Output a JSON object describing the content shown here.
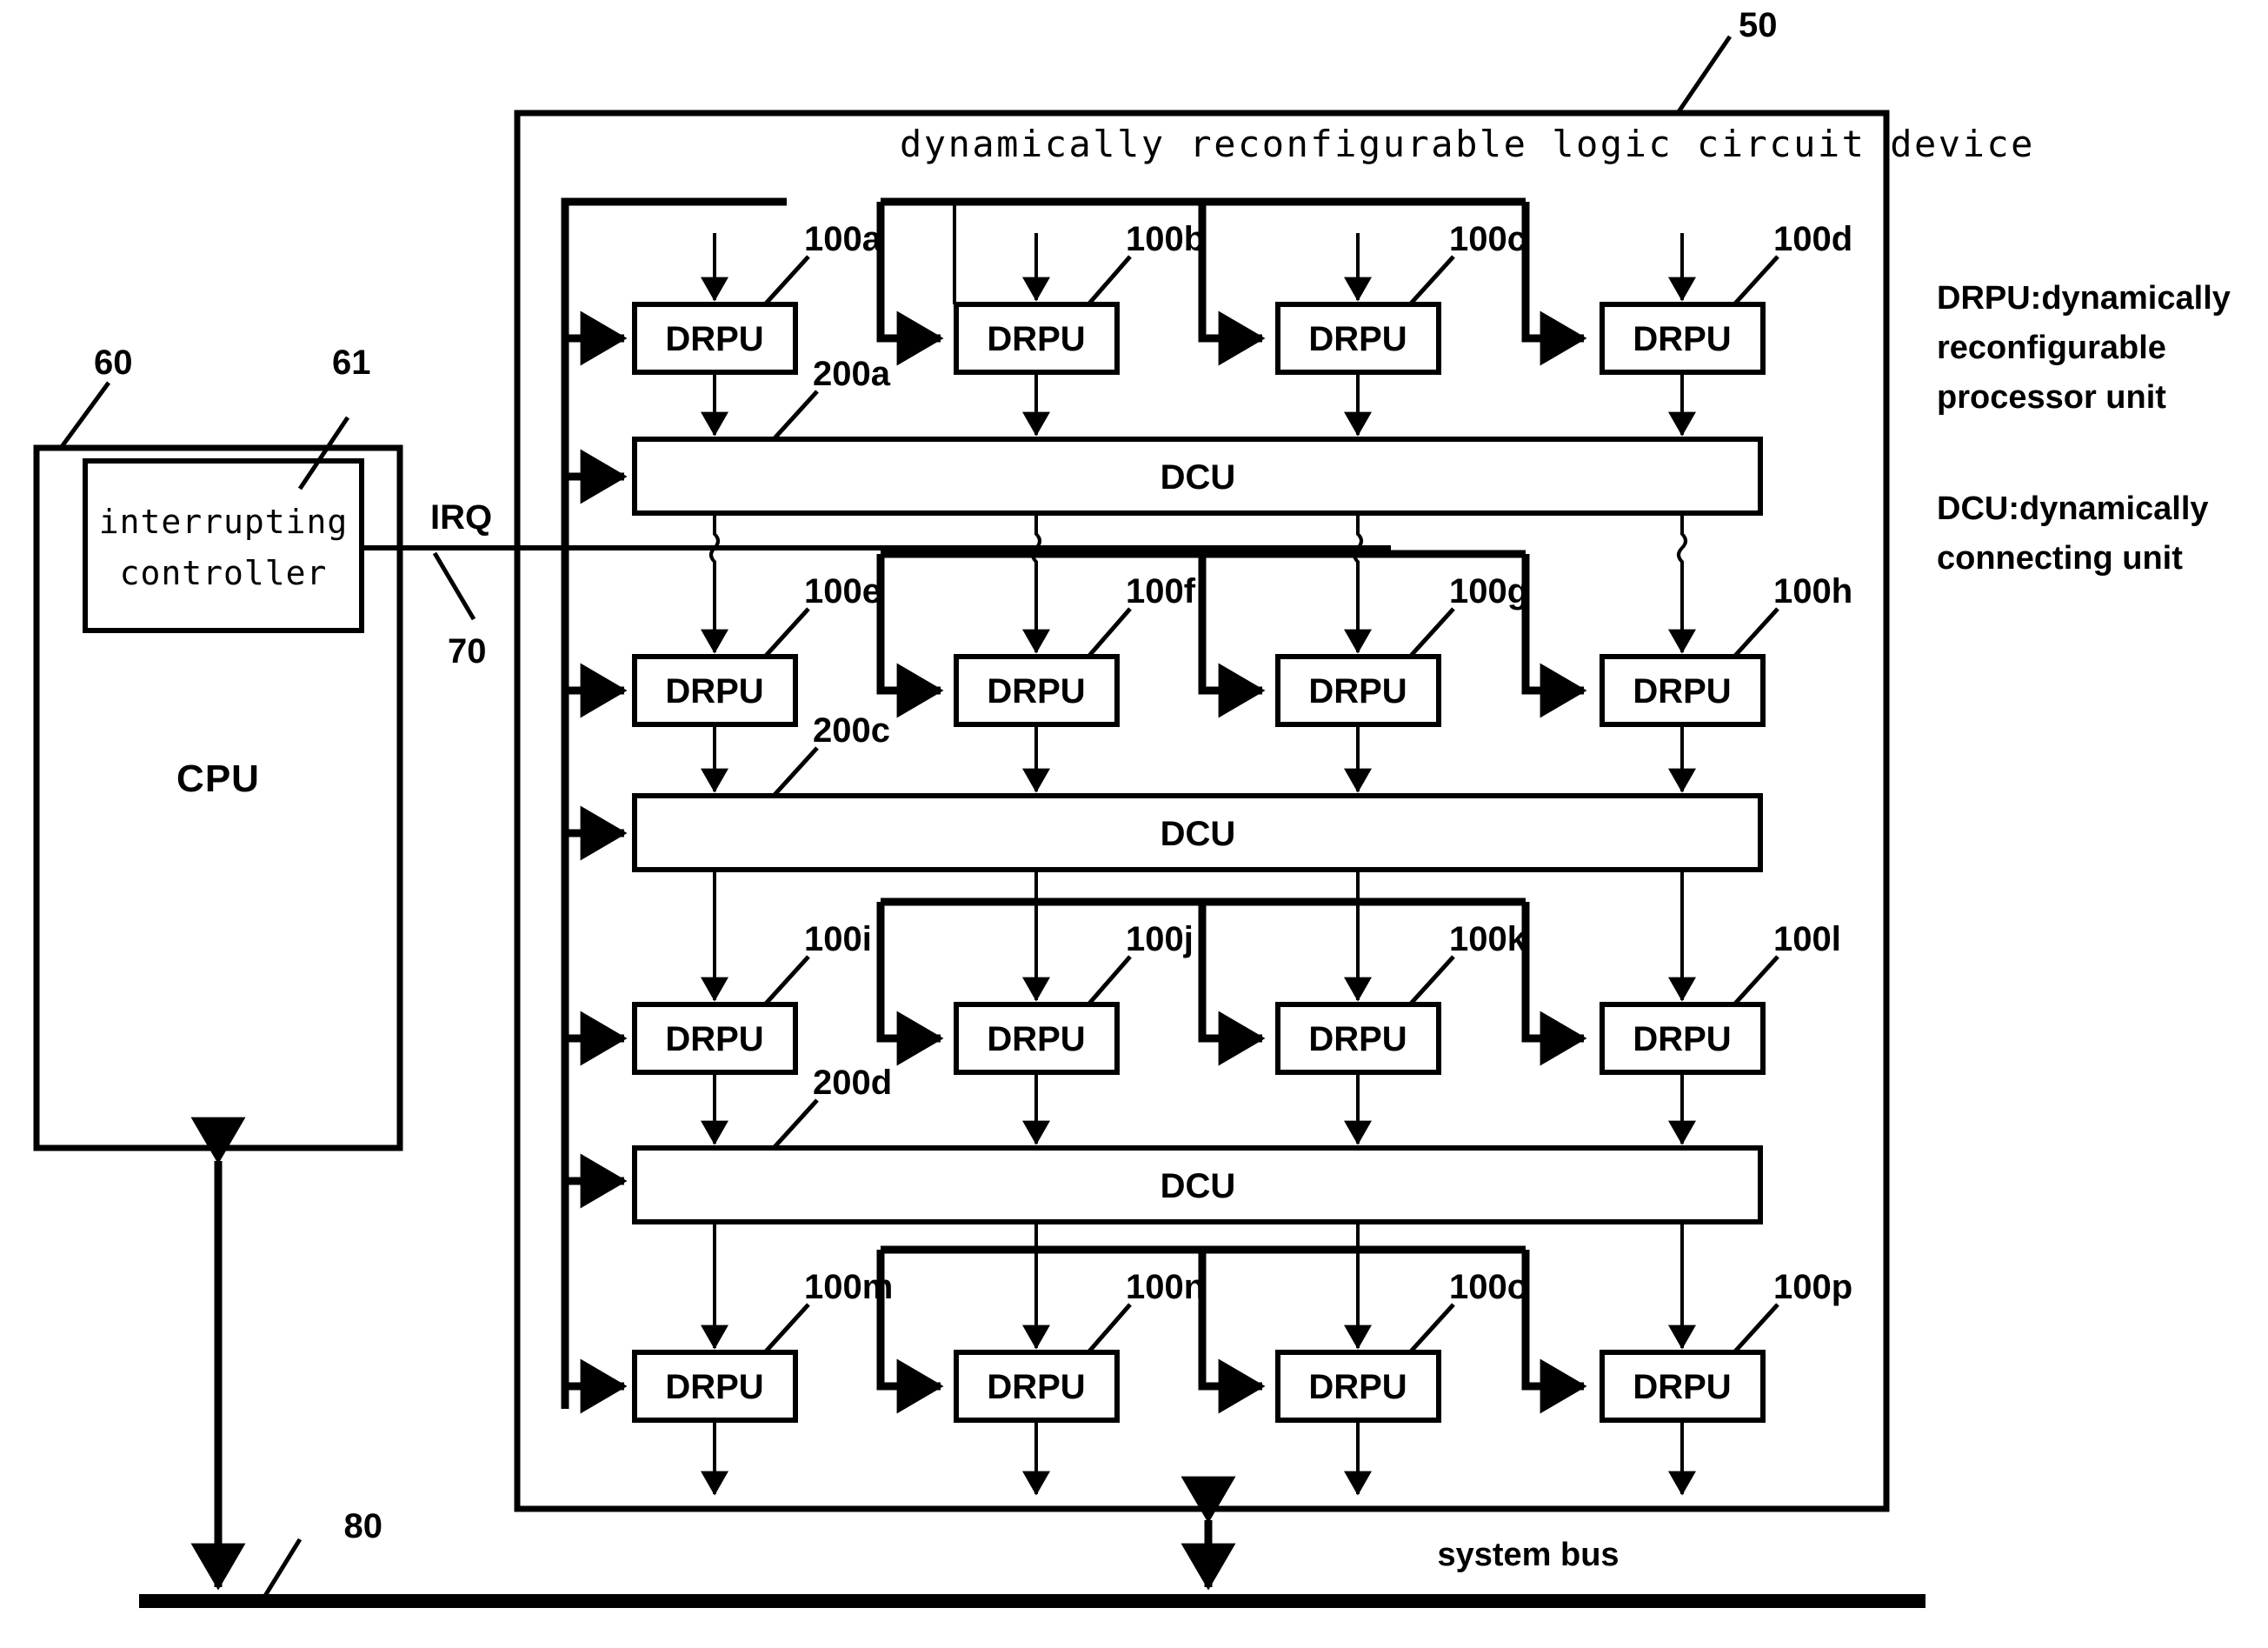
{
  "figure": {
    "device": {
      "ref": "50",
      "title": "dynamically reconfigurable logic circuit device"
    },
    "cpu": {
      "ref": "60",
      "label": "CPU",
      "interrupting_controller": {
        "ref": "61",
        "line1": "interrupting",
        "line2": "controller"
      }
    },
    "irq": {
      "label": "IRQ",
      "ref": "70"
    },
    "system_bus": {
      "label": "system bus",
      "ref": "80"
    },
    "legend": [
      {
        "key": "DRPU",
        "sep": ":",
        "lines": [
          "dynamically",
          "reconfigurable",
          "processor unit"
        ]
      },
      {
        "key": "DCU",
        "sep": ":",
        "lines": [
          "dynamically",
          "connecting unit"
        ]
      }
    ],
    "drpu_rows": [
      {
        "label": "DRPU",
        "refs": [
          "100a",
          "100b",
          "100c",
          "100d"
        ]
      },
      {
        "label": "DRPU",
        "refs": [
          "100e",
          "100f",
          "100g",
          "100h"
        ]
      },
      {
        "label": "DRPU",
        "refs": [
          "100i",
          "100j",
          "100k",
          "100l"
        ]
      },
      {
        "label": "DRPU",
        "refs": [
          "100m",
          "100n",
          "100o",
          "100p"
        ]
      }
    ],
    "dcu_rows": [
      {
        "label": "DCU",
        "ref": "200a"
      },
      {
        "label": "DCU",
        "ref": "200c"
      },
      {
        "label": "DCU",
        "ref": "200d"
      }
    ]
  },
  "colors": {
    "stroke": "#000000",
    "fill": "#ffffff",
    "background": "#ffffff"
  }
}
